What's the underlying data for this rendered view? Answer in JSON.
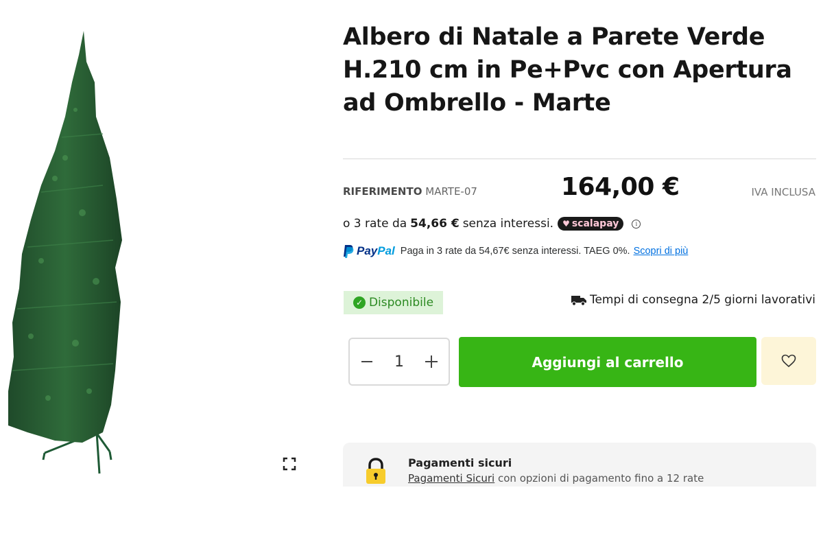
{
  "product": {
    "title": "Albero di Natale a Parete Verde H.210 cm in Pe+Pvc con Apertura ad Ombrello - Marte",
    "reference_label": "RIFERIMENTO",
    "reference_code": "MARTE-07",
    "price": "164,00 €",
    "vat_note": "IVA INCLUSA"
  },
  "scalapay": {
    "prefix": "o 3 rate da",
    "amount": "54,66 €",
    "suffix": "senza interessi.",
    "brand": "scalapay",
    "info_glyph": "i"
  },
  "paypal": {
    "brand_pay": "Pay",
    "brand_pal": "Pal",
    "text": "Paga in 3 rate da 54,67€ senza interessi. TAEG 0%.",
    "link": "Scopri di più"
  },
  "availability": {
    "status": "Disponibile",
    "delivery": "Tempi di consegna 2/5 giorni lavorativi"
  },
  "cart": {
    "quantity": "1",
    "add_label": "Aggiungi al carrello"
  },
  "secure_payments": {
    "title": "Pagamenti sicuri",
    "link": "Pagamenti Sicuri",
    "description": "con opzioni di pagamento fino a 12 rate"
  },
  "icons": {
    "expand": "expand-icon",
    "minus": "minus-icon",
    "plus": "plus-icon",
    "heart": "heart-icon",
    "truck": "truck-icon",
    "check": "check-icon",
    "lock": "lock-icon"
  },
  "colors": {
    "add_to_cart": "#37b515",
    "available_bg": "#ddf3d8",
    "available_text": "#2c8a22",
    "wishlist_bg": "#fdf5d8",
    "paypal_dark": "#003087",
    "paypal_light": "#009cde",
    "link": "#0070e0"
  }
}
